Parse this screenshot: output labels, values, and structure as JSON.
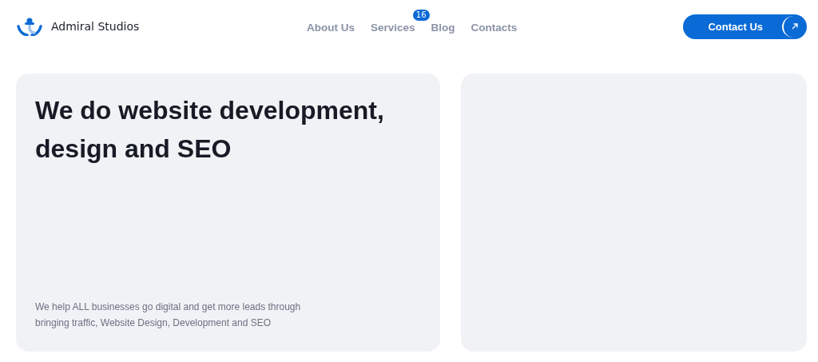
{
  "header": {
    "brand": "Admiral Studios",
    "nav": [
      {
        "label": "About Us"
      },
      {
        "label": "Services",
        "badge": "16"
      },
      {
        "label": "Blog"
      },
      {
        "label": "Contacts"
      }
    ],
    "cta": "Contact Us"
  },
  "hero": {
    "title": "We do website development, design and SEO",
    "text": "We help ALL businesses go digital and get more leads through bringing traffic, Website Design, Development and SEO"
  }
}
